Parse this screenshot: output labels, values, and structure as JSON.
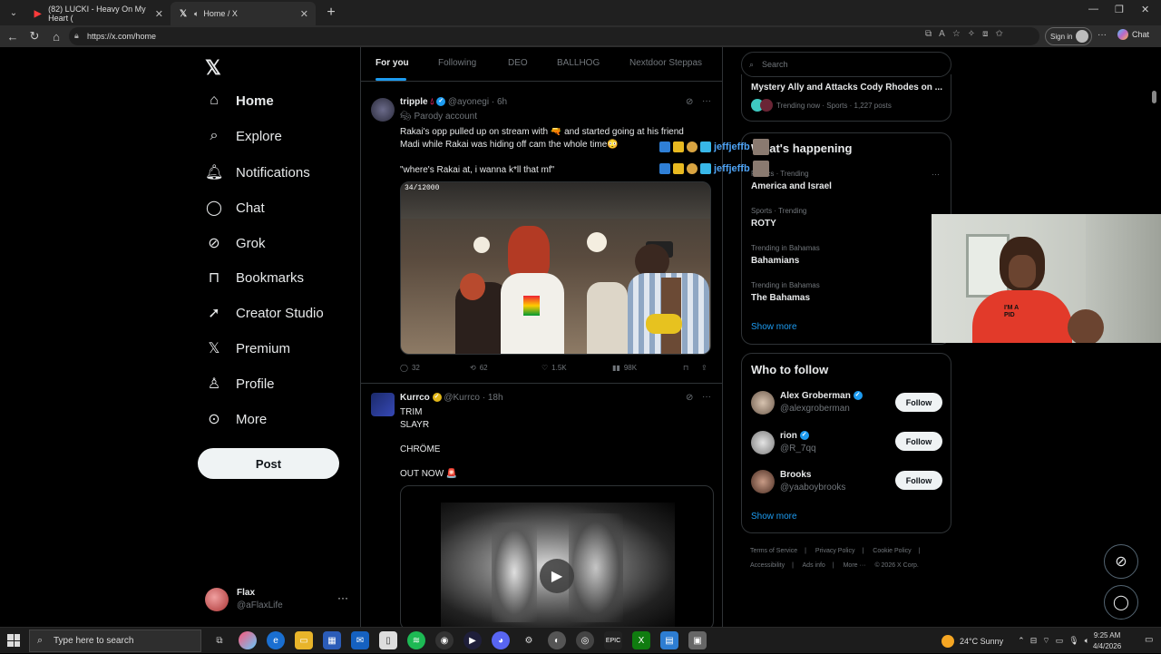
{
  "browser": {
    "tabs": [
      {
        "title": "(82) LUCKI - Heavy On My Heart (",
        "favicon": "youtube-icon",
        "active": false
      },
      {
        "title": "Home / X",
        "favicon": "x-icon",
        "active": true
      }
    ],
    "url": "https://x.com/home",
    "signin_label": "Sign in",
    "chat_label": "Chat"
  },
  "nav": {
    "logo": "𝕏",
    "items": [
      {
        "label": "Home",
        "icon": "home-icon"
      },
      {
        "label": "Explore",
        "icon": "search-icon"
      },
      {
        "label": "Notifications",
        "icon": "bell-icon"
      },
      {
        "label": "Chat",
        "icon": "chat-icon"
      },
      {
        "label": "Grok",
        "icon": "grok-icon"
      },
      {
        "label": "Bookmarks",
        "icon": "bookmark-icon"
      },
      {
        "label": "Creator Studio",
        "icon": "rocket-icon"
      },
      {
        "label": "Premium",
        "icon": "x-icon"
      },
      {
        "label": "Profile",
        "icon": "person-icon"
      },
      {
        "label": "More",
        "icon": "more-icon"
      }
    ],
    "post_label": "Post",
    "account": {
      "name": "Flax",
      "handle": "@aFlaxLife"
    }
  },
  "feed_tabs": [
    "For you",
    "Following",
    "DEO",
    "BALLHOG",
    "Nextdoor Steppas"
  ],
  "tweets": [
    {
      "name": "tripple",
      "handle": "@ayonegi",
      "time": "6h",
      "label": "Parody account",
      "text1": "Rakai's opp pulled up on stream with 🔫 and started going at his friend",
      "text2": "Madi while Rakai was hiding off cam the whole time😳",
      "text3": "\"where's Rakai at, i wanna k*ll that mf\"",
      "video_counter": "34/12000",
      "replies": "32",
      "reposts": "62",
      "likes": "1.5K",
      "views": "98K"
    },
    {
      "name": "Kurrco",
      "handle": "@Kurrco",
      "time": "18h",
      "lines": [
        "TRIM",
        "SLAYR",
        "",
        "CHRÖME",
        "",
        "OUT NOW 🚨"
      ]
    }
  ],
  "right": {
    "search_placeholder": "Search",
    "top_trend": {
      "headline": "Mystery Ally and Attacks Cody Rhodes on ...",
      "meta": "Trending now · Sports · 1,227 posts"
    },
    "whats_happening_title": "What's happening",
    "trends": [
      {
        "category": "Politics · Trending",
        "name": "America and Israel"
      },
      {
        "category": "Sports · Trending",
        "name": "ROTY"
      },
      {
        "category": "Trending in Bahamas",
        "name": "Bahamians"
      },
      {
        "category": "Trending in Bahamas",
        "name": "The Bahamas"
      }
    ],
    "show_more": "Show more",
    "who_to_follow_title": "Who to follow",
    "follow_suggestions": [
      {
        "name": "Alex Groberman",
        "handle": "@alexgroberman",
        "follow_label": "Follow"
      },
      {
        "name": "rion",
        "handle": "@R_7qq",
        "follow_label": "Follow"
      },
      {
        "name": "Brooks",
        "handle": "@yaaboybrooks",
        "follow_label": "Follow"
      }
    ],
    "footer": [
      "Terms of Service",
      "|",
      "Privacy Policy",
      "|",
      "Cookie Policy",
      "|",
      "Accessibility",
      "|",
      "Ads info",
      "|",
      "More ···",
      "© 2026 X Corp."
    ]
  },
  "overlay_chat": [
    {
      "user": "jeffjeffb"
    },
    {
      "user": "jeffjeffb"
    }
  ],
  "webcam": {
    "shirt_text": "I'M A\nPID"
  },
  "taskbar": {
    "search_placeholder": "Type here to search",
    "weather": "24°C  Sunny",
    "time": "9:25 AM",
    "date": "4/4/2026"
  },
  "colors": {
    "accent": "#1d9bf0",
    "background": "#000000",
    "border": "#2f3336",
    "muted": "#71767b"
  }
}
